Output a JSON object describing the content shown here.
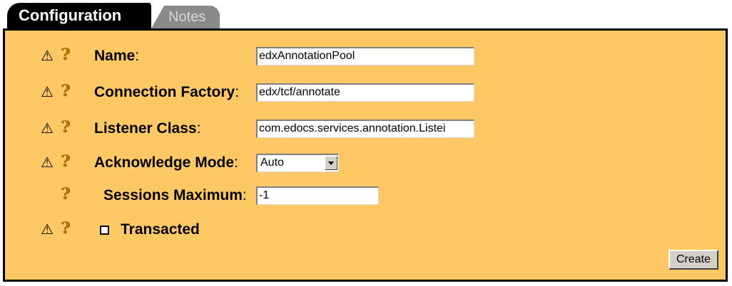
{
  "tabs": [
    {
      "label": "Configuration",
      "active": true
    },
    {
      "label": "Notes",
      "active": false
    }
  ],
  "icons": {
    "warning": "⚠",
    "help": "?"
  },
  "fields": {
    "name": {
      "label": "Name",
      "colon": ":",
      "value": "edxAnnotationPool"
    },
    "connection_factory": {
      "label": "Connection Factory",
      "colon": ":",
      "value": "edx/tcf/annotate"
    },
    "listener_class": {
      "label": "Listener Class",
      "colon": ":",
      "value": "com.edocs.services.annotation.Listei"
    },
    "acknowledge_mode": {
      "label": "Acknowledge Mode",
      "colon": ":",
      "value": "Auto"
    },
    "sessions_maximum": {
      "label": "Sessions Maximum",
      "colon": ":",
      "value": "-1"
    },
    "transacted": {
      "label": "Transacted",
      "checked": false
    }
  },
  "buttons": {
    "create": "Create"
  },
  "colors": {
    "panel_background": "#fec864",
    "active_tab": "#000000",
    "inactive_tab": "#8a8a8a"
  }
}
